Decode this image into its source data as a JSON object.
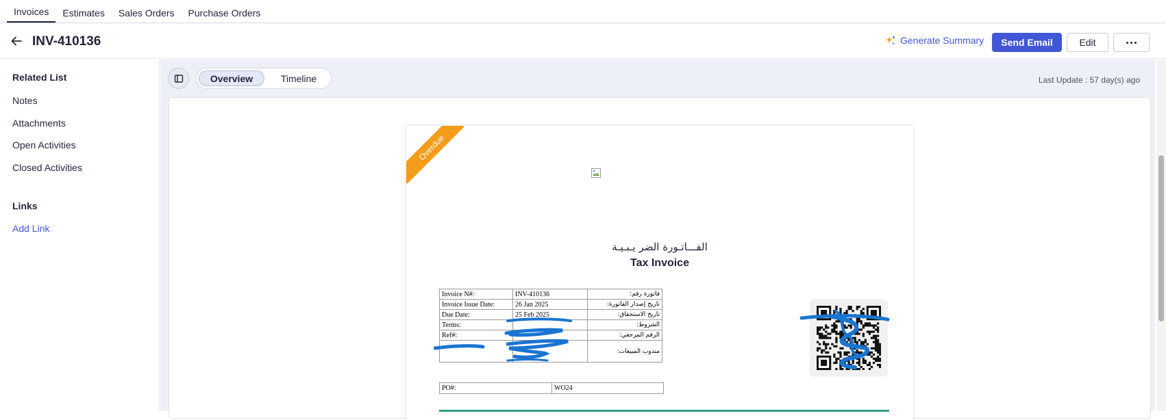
{
  "top_tabs": [
    "Invoices",
    "Estimates",
    "Sales Orders",
    "Purchase Orders"
  ],
  "header": {
    "title": "INV-410136",
    "generate_summary": "Generate Summary",
    "send_email": "Send Email",
    "edit": "Edit"
  },
  "sidebar": {
    "related_title": "Related List",
    "items": [
      "Notes",
      "Attachments",
      "Open Activities",
      "Closed Activities"
    ],
    "links_title": "Links",
    "add_link": "Add Link"
  },
  "main": {
    "tabs": [
      "Overview",
      "Timeline"
    ],
    "last_update": "Last Update : 57 day(s) ago"
  },
  "invoice": {
    "status_ribbon": "Overdue",
    "title_ar": "الفـــاتـورة الضر يـبـيـة",
    "title_en": "Tax Invoice",
    "rows": [
      {
        "label": "Invoice N#:",
        "value": "INV-410136",
        "label_ar": "فاتورة رقم:"
      },
      {
        "label": "Invoice Issue Date:",
        "value": "26 Jan 2025",
        "label_ar": "تاريخ إصدار الفاتورة:"
      },
      {
        "label": "Due Date:",
        "value": "25 Feb 2025",
        "label_ar": "تاريخ الاستحقاق:"
      },
      {
        "label": "Terms:",
        "value": "",
        "label_ar": "الشروط:"
      },
      {
        "label": "Ref#:",
        "value": "",
        "label_ar": "الرقم المرجعي:"
      },
      {
        "label": "",
        "value": "",
        "label_ar": "مندوب المبيعات:"
      }
    ],
    "po_label": "PO#:",
    "po_value": "WO24"
  },
  "colors": {
    "accent": "#4157d6",
    "ribbon": "#f59c1a",
    "scribble": "#1a74d1",
    "table_rule": "#2e9c8a"
  }
}
